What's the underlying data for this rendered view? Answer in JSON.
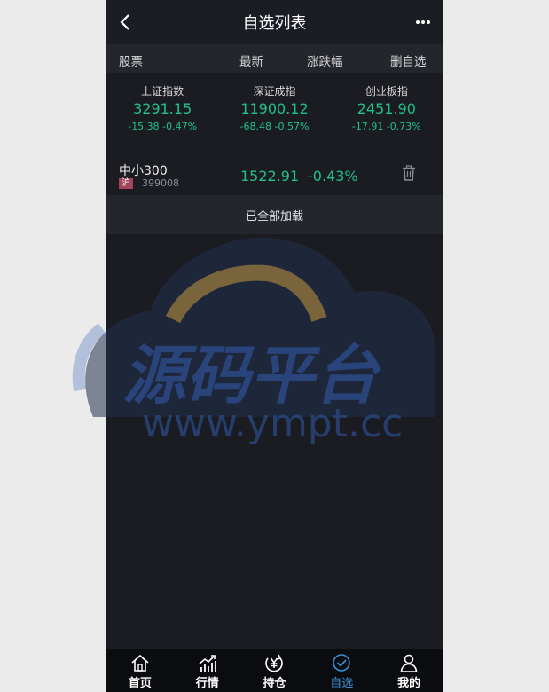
{
  "header": {
    "title": "自选列表"
  },
  "columns": {
    "stock": "股票",
    "latest": "最新",
    "change": "涨跌幅",
    "delete": "删自选"
  },
  "indices": [
    {
      "name": "上证指数",
      "price": "3291.15",
      "change": "-15.38 -0.47%"
    },
    {
      "name": "深证成指",
      "price": "11900.12",
      "change": "-68.48 -0.57%"
    },
    {
      "name": "创业板指",
      "price": "2451.90",
      "change": "-17.91 -0.73%"
    }
  ],
  "watchlist": [
    {
      "name": "中小300",
      "market": "沪",
      "code": "399008",
      "price": "1522.91",
      "change": "-0.43%"
    }
  ],
  "load_status": "已全部加载",
  "watermark": {
    "title": "源码平台",
    "url": "www.ympt.cc"
  },
  "tabs": [
    {
      "label": "首页",
      "icon": "home-icon"
    },
    {
      "label": "行情",
      "icon": "chart-icon"
    },
    {
      "label": "持仓",
      "icon": "yen-icon"
    },
    {
      "label": "自选",
      "icon": "check-circle-icon",
      "active": true
    },
    {
      "label": "我的",
      "icon": "user-icon"
    }
  ],
  "colors": {
    "up_down": "#20c08a",
    "active_tab": "#3a8fd6",
    "market_badge": "#a4435b"
  }
}
